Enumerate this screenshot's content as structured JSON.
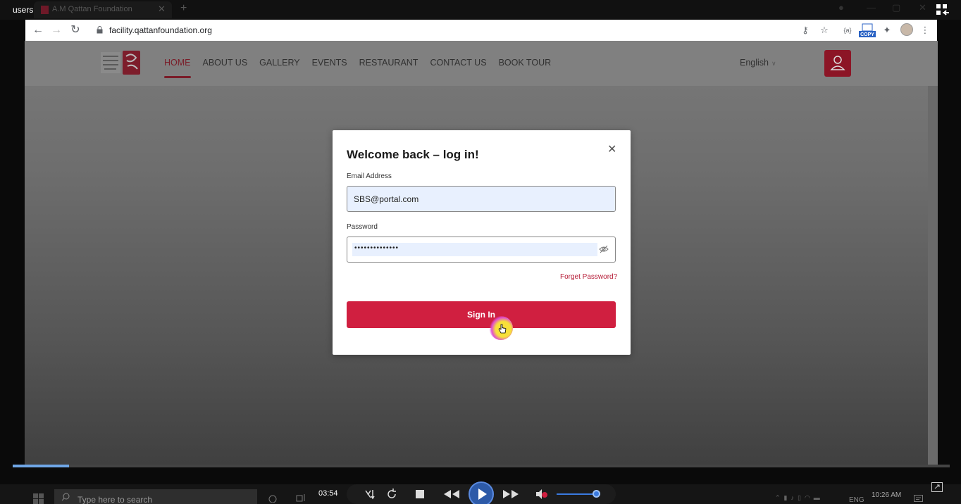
{
  "player": {
    "title": "users",
    "time": "03:54",
    "progress_fraction": 0.06,
    "volume_fraction": 0.9
  },
  "browser": {
    "tab_title": "A.M Qattan Foundation",
    "url": "facility.qattanfoundation.org",
    "copy_badge": "COPY"
  },
  "site": {
    "menu": [
      "HOME",
      "ABOUT US",
      "GALLERY",
      "EVENTS",
      "RESTAURANT",
      "CONTACT US",
      "BOOK TOUR"
    ],
    "active_menu": "HOME",
    "language": "English",
    "colors": {
      "brand": "#d01f40",
      "brand_dark": "#8c1526"
    }
  },
  "login": {
    "title": "Welcome back – log in!",
    "email_label": "Email Address",
    "email_value": "SBS@portal.com",
    "password_label": "Password",
    "password_masked": "••••••••••••••",
    "forget_link": "Forget Password?",
    "signin_label": "Sign In"
  },
  "taskbar": {
    "search_placeholder": "Type here to search",
    "lang": "ENG",
    "clock": "10:26 AM"
  }
}
